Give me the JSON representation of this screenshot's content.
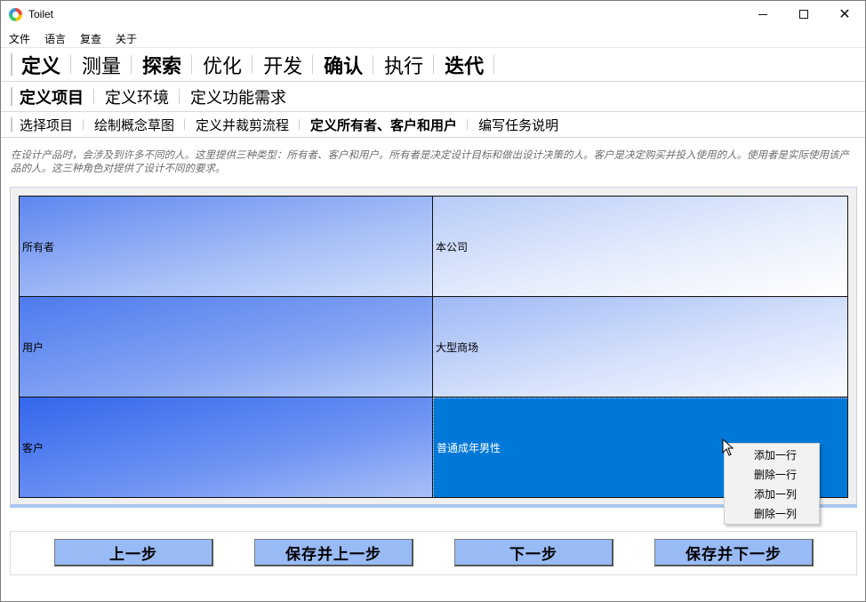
{
  "window": {
    "title": "Toilet"
  },
  "menu": [
    "文件",
    "语言",
    "复查",
    "关于"
  ],
  "phase_tabs": [
    {
      "label": "定义",
      "active": true
    },
    {
      "label": "测量",
      "active": false
    },
    {
      "label": "探索",
      "active": false
    },
    {
      "label": "优化",
      "active": false
    },
    {
      "label": "开发",
      "active": false
    },
    {
      "label": "确认",
      "active": false
    },
    {
      "label": "执行",
      "active": false
    },
    {
      "label": "迭代",
      "active": false
    }
  ],
  "sub_tabs": [
    {
      "label": "定义项目",
      "active": true
    },
    {
      "label": "定义环境",
      "active": false
    },
    {
      "label": "定义功能需求",
      "active": false
    }
  ],
  "step_tabs": [
    {
      "label": "选择项目",
      "active": false
    },
    {
      "label": "绘制概念草图",
      "active": false
    },
    {
      "label": "定义并裁剪流程",
      "active": false
    },
    {
      "label": "定义所有者、客户和用户",
      "active": true
    },
    {
      "label": "编写任务说明",
      "active": false
    }
  ],
  "description": "在设计产品时，会涉及到许多不同的人。这里提供三种类型：所有者、客户和用户。所有者是决定设计目标和做出设计决策的人。客户是决定购买并投入使用的人。使用者是实际使用该产品的人。这三种角色对提供了设计不同的要求。",
  "table": {
    "rows": [
      {
        "role": "所有者",
        "value": "本公司"
      },
      {
        "role": "用户",
        "value": "大型商场"
      },
      {
        "role": "客户",
        "value": "普通成年男性"
      }
    ],
    "selected_cell": "普通成年男性"
  },
  "context_menu": [
    "添加一行",
    "删除一行",
    "添加一列",
    "删除一列"
  ],
  "buttons": {
    "prev": "上一步",
    "save_prev": "保存并上一步",
    "next": "下一步",
    "save_next": "保存并下一步"
  },
  "colors": {
    "selected_cell": "#0078d7",
    "button_bg": "#98bbf6"
  }
}
